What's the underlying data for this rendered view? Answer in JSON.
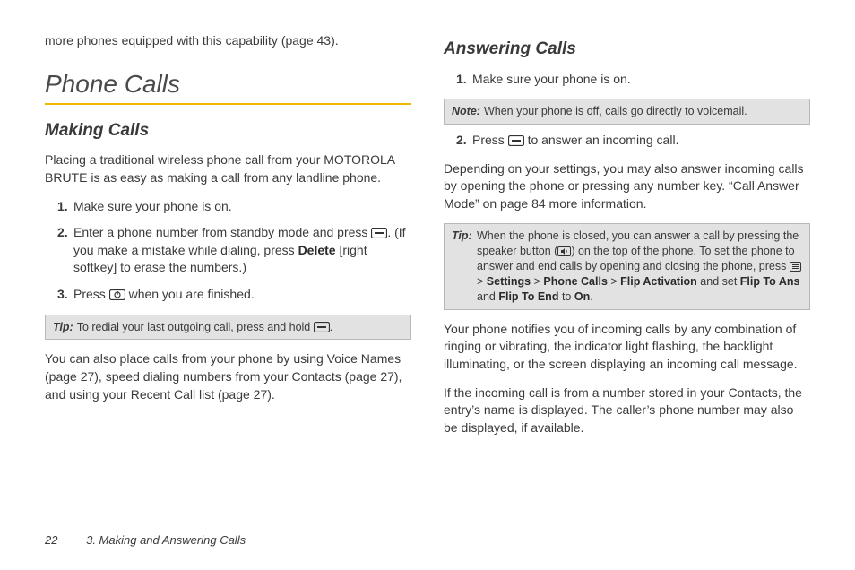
{
  "left": {
    "intro_frag": "more phones equipped with this capability (page 43).",
    "h1": "Phone Calls",
    "h2": "Making Calls",
    "p1": "Placing a traditional wireless phone call from your MOTOROLA BRUTE is as easy as making a call from any landline phone.",
    "li1": "Make sure your phone is on.",
    "li2a": "Enter a phone number from standby mode and press ",
    "li2b": ". (If you make a mistake while dialing, press ",
    "li2_delete": "Delete",
    "li2c": " [right softkey] to erase the numbers.)",
    "li3a": "Press ",
    "li3b": " when you are finished.",
    "tip_label": "Tip:",
    "tip_a": "To redial your last outgoing call, press and hold ",
    "tip_b": ".",
    "p2": "You can also place calls from your phone by using Voice Names (page 27), speed dialing numbers from your Contacts (page 27), and using your Recent Call list (page 27)."
  },
  "right": {
    "h2": "Answering Calls",
    "li1": "Make sure your phone is on.",
    "note_label": "Note:",
    "note_body": "When your phone is off, calls go directly to voicemail.",
    "li2a": "Press ",
    "li2b": " to answer an incoming call.",
    "p1": "Depending on your settings, you may also answer incoming calls by opening the phone or pressing any number key. “Call Answer Mode” on page 84 more information.",
    "tip_label": "Tip:",
    "tip_a": "When the phone is closed, you can answer a call by pressing the speaker button (",
    "tip_b": ") on the top of the phone. To set the phone to answer and end calls by opening and closing the phone, press ",
    "tip_settings": "Settings",
    "tip_phone_calls": "Phone Calls",
    "tip_flip_act": "Flip Activation",
    "tip_and_set": " and set ",
    "tip_flip_ans": "Flip To Ans",
    "tip_and": " and ",
    "tip_flip_end": "Flip To End",
    "tip_to": " to ",
    "tip_on": "On",
    "tip_dot": ".",
    "p2": "Your phone notifies you of incoming calls by any combination of ringing or vibrating, the indicator light flashing, the backlight illuminating, or the screen displaying an incoming call message.",
    "p3": "If the incoming call is from a number stored in your Contacts, the entry’s name is displayed. The caller’s phone number may also be displayed, if available."
  },
  "footer": {
    "page": "22",
    "chapter": "3. Making and Answering Calls"
  }
}
